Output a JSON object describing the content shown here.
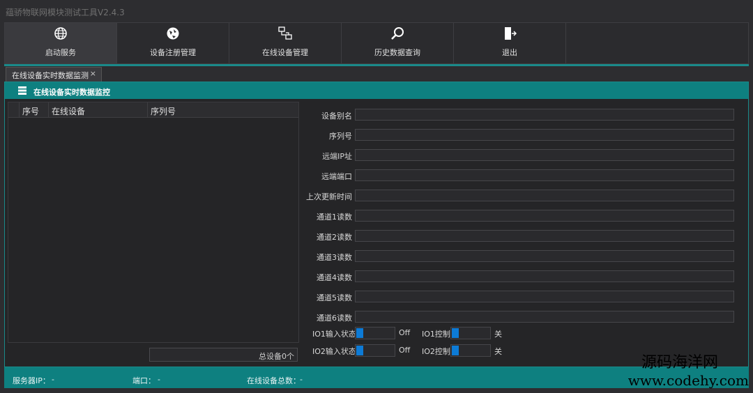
{
  "app": {
    "title": "蕴骄物联网模块测试工具V2.4.3"
  },
  "toolbar": {
    "items": [
      {
        "label": "启动服务",
        "icon": "globe-icon"
      },
      {
        "label": "设备注册管理",
        "icon": "registration-icon"
      },
      {
        "label": "在线设备管理",
        "icon": "network-icon"
      },
      {
        "label": "历史数据查询",
        "icon": "search-icon"
      },
      {
        "label": "退出",
        "icon": "exit-door-icon"
      }
    ]
  },
  "tab": {
    "label": "在线设备实时数据监测",
    "close": "×"
  },
  "panel": {
    "title": "在线设备实时数据监控"
  },
  "grid": {
    "columns": [
      "序号",
      "在线设备",
      "序列号"
    ],
    "rows": [],
    "total": "总设备0个"
  },
  "form": {
    "fields": [
      {
        "label": "设备别名",
        "value": ""
      },
      {
        "label": "序列号",
        "value": ""
      },
      {
        "label": "远端IP址",
        "value": ""
      },
      {
        "label": "远端端口",
        "value": ""
      },
      {
        "label": "上次更新时间",
        "value": ""
      },
      {
        "label": "通道1读数",
        "value": ""
      },
      {
        "label": "通道2读数",
        "value": ""
      },
      {
        "label": "通道3读数",
        "value": ""
      },
      {
        "label": "通道4读数",
        "value": ""
      },
      {
        "label": "通道5读数",
        "value": ""
      },
      {
        "label": "通道6读数",
        "value": ""
      }
    ],
    "io": {
      "io1_input_label": "IO1输入状态",
      "io1_input_state": "Off",
      "io1_control_label": "IO1控制",
      "io1_control_state": "关",
      "io2_input_label": "IO2输入状态",
      "io2_input_state": "Off",
      "io2_control_label": "IO2控制",
      "io2_control_state": "关"
    }
  },
  "status": {
    "server_ip_label": "服务器IP：",
    "server_ip_value": "-",
    "port_label": "端口：",
    "port_value": "-",
    "online_total_label": "在线设备总数：",
    "online_total_value": "-"
  },
  "watermark": {
    "line1": "源码海洋网",
    "line2": "www.codehy.com"
  },
  "colors": {
    "accent": "#0e8080",
    "toggle": "#0d7bd6",
    "background": "#2d2d30"
  }
}
